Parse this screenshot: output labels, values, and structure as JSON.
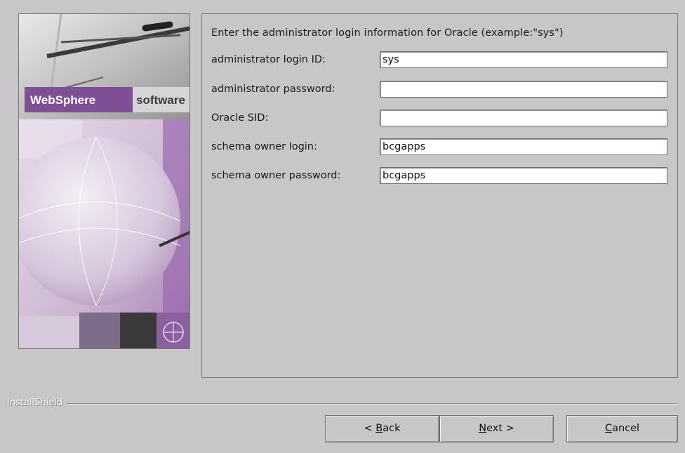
{
  "banner": {
    "brand_name": "WebSphere",
    "brand_suffix": "software",
    "colors": {
      "purple": "#7e4f95",
      "light_purple": "#dcd3e0"
    }
  },
  "form": {
    "intro": "Enter the administrator login information for Oracle (example:\"sys\")",
    "fields": [
      {
        "label": "administrator login ID:",
        "value": "sys"
      },
      {
        "label": "administrator password:",
        "value": ""
      },
      {
        "label": "Oracle SID:",
        "value": ""
      },
      {
        "label": "schema owner login:",
        "value": "bcgapps"
      },
      {
        "label": "schema owner password:",
        "value": "bcgapps"
      }
    ]
  },
  "footer": {
    "brand": "InstallShield",
    "buttons": {
      "back": {
        "pre": "< ",
        "mnemonic": "B",
        "post": "ack"
      },
      "next": {
        "pre": "",
        "mnemonic": "N",
        "post": "ext >"
      },
      "cancel": {
        "pre": "",
        "mnemonic": "C",
        "post": "ancel"
      }
    }
  }
}
